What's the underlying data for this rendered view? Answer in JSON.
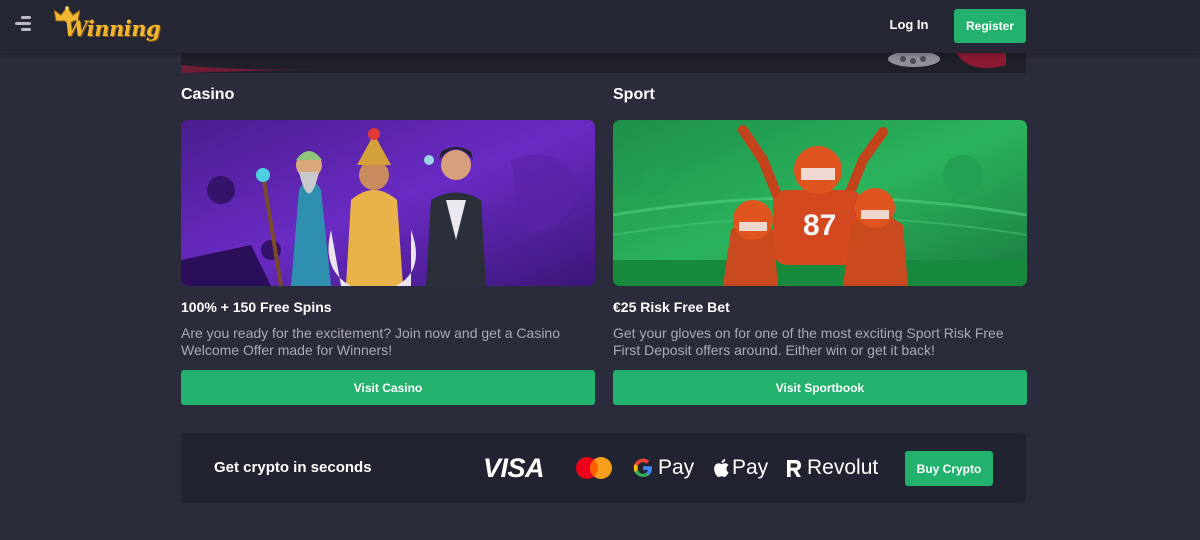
{
  "header": {
    "logo_text": "Winning",
    "login_label": "Log In",
    "register_label": "Register"
  },
  "sections": [
    {
      "title": "Casino",
      "offer_title": "100% + 150 Free Spins",
      "description": "Are you ready for the excitement? Join now and get a Casino Welcome Offer made for Winners!",
      "button_label": "Visit Casino"
    },
    {
      "title": "Sport",
      "offer_title": "€25 Risk Free Bet",
      "description": "Get your gloves on for one of the most exciting Sport Risk Free First Deposit offers around. Either win or get it back!",
      "button_label": "Visit Sportbook"
    }
  ],
  "crypto": {
    "title": "Get crypto in seconds",
    "payment_methods": {
      "visa": "VISA",
      "mastercard": "mastercard-icon",
      "google_pay": "Pay",
      "apple_pay": "Pay",
      "revolut": "Revolut"
    },
    "button_label": "Buy Crypto"
  },
  "icons": {
    "menu": "menu-icon",
    "crown": "crown-icon",
    "google": "google-icon",
    "apple": "apple-icon",
    "revolut": "revolut-icon"
  },
  "colors": {
    "background": "#2b2c3b",
    "header": "#262734",
    "accent_green": "#23b26d",
    "logo_gold": "#f2b632",
    "muted_text": "#a9aab8",
    "casino_purple": "#6a2bc4",
    "sport_green": "#2bb35c"
  }
}
